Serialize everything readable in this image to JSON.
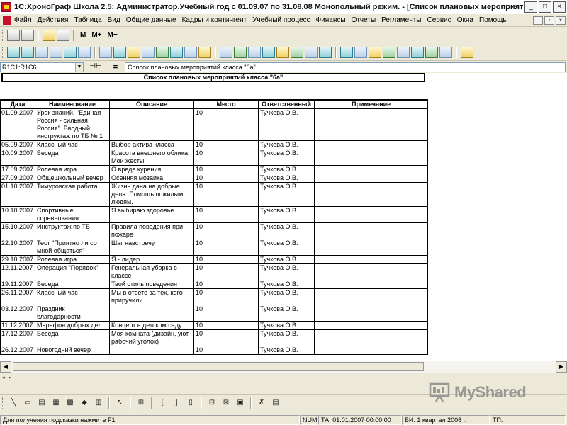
{
  "window": {
    "title": "1С:ХроноГраф Школа 2.5: Администратор.Учебный год с 01.09.07 по 31.08.08 Монопольный режим. - [Список плановых мероприятий *]",
    "min": "_",
    "max": "□",
    "close": "×"
  },
  "menu": [
    "Файл",
    "Действия",
    "Таблица",
    "Вид",
    "Общие данные",
    "Кадры и контингент",
    "Учебный процесс",
    "Финансы",
    "Отчеты",
    "Регламенты",
    "Сервис",
    "Окна",
    "Помощь"
  ],
  "toolbar1": {
    "m": "M",
    "m_plus": "M+",
    "m_minus": "M−"
  },
  "addressbar": {
    "cell": "R1C1:R1C6",
    "eq": "=",
    "formula": "Список плановых мероприятий класса \"6а\""
  },
  "sheet": {
    "title": "Список плановых мероприятий класса \"6а\"",
    "columns": {
      "date": "Дата",
      "name": "Наименование",
      "description": "Описание",
      "place": "Место",
      "responsible": "Ответственный",
      "note": "Примечание"
    },
    "rows": [
      {
        "date": "01.09.2007",
        "name": "Урок знаний. \"Единая Россия - сильная Россия\". Вводный инструктаж по ТБ № 1",
        "description": "",
        "place": "10",
        "responsible": "Тучкова О.В.",
        "note": ""
      },
      {
        "date": "05.09.2007",
        "name": "Классный час",
        "description": "Выбор актива класса",
        "place": "10",
        "responsible": "Тучкова О.В.",
        "note": ""
      },
      {
        "date": "10.09.2007",
        "name": "Беседа",
        "description": "Красота внешнего облика. Мои жесты",
        "place": "10",
        "responsible": "Тучкова О.В.",
        "note": ""
      },
      {
        "date": "17.09.2007",
        "name": "Ролевая игра",
        "description": "О вреде курения",
        "place": "10",
        "responsible": "Тучкова О.В.",
        "note": ""
      },
      {
        "date": "27.09.2007",
        "name": "Общешкольный вечер",
        "description": "Осенняя мозаика",
        "place": "10",
        "responsible": "Тучкова О.В.",
        "note": ""
      },
      {
        "date": "01.10.2007",
        "name": "Тимуровская работа",
        "description": "Жизнь дана на добрые дела. Помощь пожилым людям.",
        "place": "10",
        "responsible": "Тучкова О.В.",
        "note": ""
      },
      {
        "date": "10.10.2007",
        "name": "Спортивные соревнования",
        "description": "Я выбираю здоровье",
        "place": "10",
        "responsible": "Тучкова О.В.",
        "note": ""
      },
      {
        "date": "15.10.2007",
        "name": "Инструктаж по ТБ",
        "description": "Правила поведения при пожаре",
        "place": "10",
        "responsible": "Тучкова О.В.",
        "note": ""
      },
      {
        "date": "22.10.2007",
        "name": "Тест \"Приятно ли со мной общаться\"",
        "description": "Шаг навстречу",
        "place": "10",
        "responsible": "Тучкова О.В.",
        "note": ""
      },
      {
        "date": "29.10.2007",
        "name": "Ролевая игра",
        "description": "Я - лидер",
        "place": "10",
        "responsible": "Тучкова О.В.",
        "note": ""
      },
      {
        "date": "12.11.2007",
        "name": "Операция \"Порядок\"",
        "description": "Генеральная уборка в классе",
        "place": "10",
        "responsible": "Тучкова О.В.",
        "note": ""
      },
      {
        "date": "19.11.2007",
        "name": "Беседа",
        "description": "Твой стиль поведения",
        "place": "10",
        "responsible": "Тучкова О.В.",
        "note": ""
      },
      {
        "date": "26.11.2007",
        "name": "Классный час",
        "description": "Мы в ответе за тех, кого приручили",
        "place": "10",
        "responsible": "Тучкова О.В.",
        "note": ""
      },
      {
        "date": "03.12.2007",
        "name": "Праздник благодарности",
        "description": "",
        "place": "10",
        "responsible": "Тучкова О.В.",
        "note": ""
      },
      {
        "date": "11.12.2007",
        "name": "Марафон добрых дел",
        "description": "Концерт в детском саду",
        "place": "10",
        "responsible": "Тучкова О.В.",
        "note": ""
      },
      {
        "date": "17.12.2007",
        "name": "Беседа",
        "description": "Моя комната (дизайн, уют, рабочий уголок)",
        "place": "10",
        "responsible": "Тучкова О.В.",
        "note": ""
      },
      {
        "date": "26.12.2007",
        "name": "Новогодний вечер",
        "description": "",
        "place": "10",
        "responsible": "Тучкова О.В.",
        "note": ""
      }
    ]
  },
  "drawbar": {
    "bracket_open": "[",
    "bracket_close": "]"
  },
  "status": {
    "hint": "Для получения подсказки нажмите F1",
    "num": "NUM",
    "ta": "ТА: 01.01.2007 00:00:00",
    "bi": "БИ: 1 квартал 2008 г.",
    "tp": "ТП:"
  },
  "watermark": {
    "text": "MyShared"
  }
}
